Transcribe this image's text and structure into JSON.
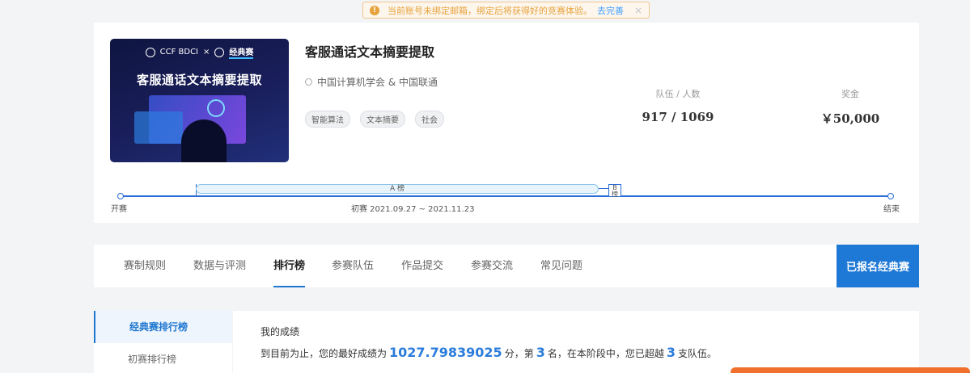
{
  "notice": {
    "text": "当前账号未绑定邮箱，绑定后将获得好的竞赛体验。",
    "link": "去完善",
    "close": "×"
  },
  "banner": {
    "brand": "CCF BDCI",
    "cross": "×",
    "tag": "经典赛",
    "title": "客服通话文本摘要提取"
  },
  "competition": {
    "title": "客服通话文本摘要提取",
    "organizer": "中国计算机学会 & 中国联通",
    "tags": [
      "智能算法",
      "文本摘要",
      "社会"
    ]
  },
  "stats": {
    "teams_label": "队伍 / 人数",
    "teams_value": "917 / 1069",
    "prize_label": "奖金",
    "prize_value": "￥50,000"
  },
  "timeline": {
    "start": "开赛",
    "end": "结束",
    "stage": "初赛 2021.09.27 ~ 2021.11.23",
    "board_a": "A 榜",
    "board_b": "B 榜"
  },
  "tabs": [
    "赛制规则",
    "数据与评测",
    "排行榜",
    "参赛队伍",
    "作品提交",
    "参赛交流",
    "常见问题"
  ],
  "register_button": "已报名经典赛",
  "sidebar": [
    "经典赛排行榜",
    "初赛排行榜"
  ],
  "result": {
    "title": "我的成绩",
    "prefix": "到目前为止，您的最好成绩为",
    "score": "1027.79839025",
    "unit": "分，第",
    "rank": "3",
    "mid": "名，在本阶段中，您已超越",
    "beaten": "3",
    "suffix": "支队伍。"
  }
}
